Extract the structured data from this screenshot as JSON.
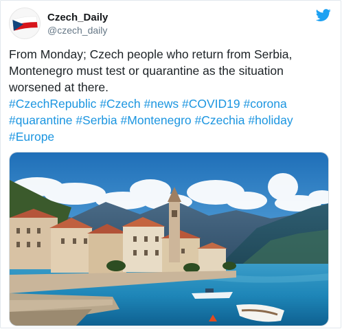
{
  "account": {
    "display_name": "Czech_Daily",
    "handle": "@czech_daily"
  },
  "icons": {
    "avatar": "czech-flag",
    "brand": "twitter-bird-icon"
  },
  "tweet": {
    "text": "From Monday; Czech people who return from Serbia, Montenegro must test or quarantine as the situation worsened at there.",
    "hashtags": [
      "#CzechRepublic",
      "#Czech",
      "#news",
      "#COVID19",
      "#corona",
      "#quarantine",
      "#Serbia",
      "#Montenegro",
      "#Czechia",
      "#holiday",
      "#Europe"
    ]
  },
  "colors": {
    "hashtag": "#1b95e0",
    "twitter_blue": "#1da1f2",
    "text": "#1c2226",
    "handle": "#657786"
  },
  "media": {
    "type": "photo",
    "subject": "coastal town with bell tower, mountains and bay"
  }
}
